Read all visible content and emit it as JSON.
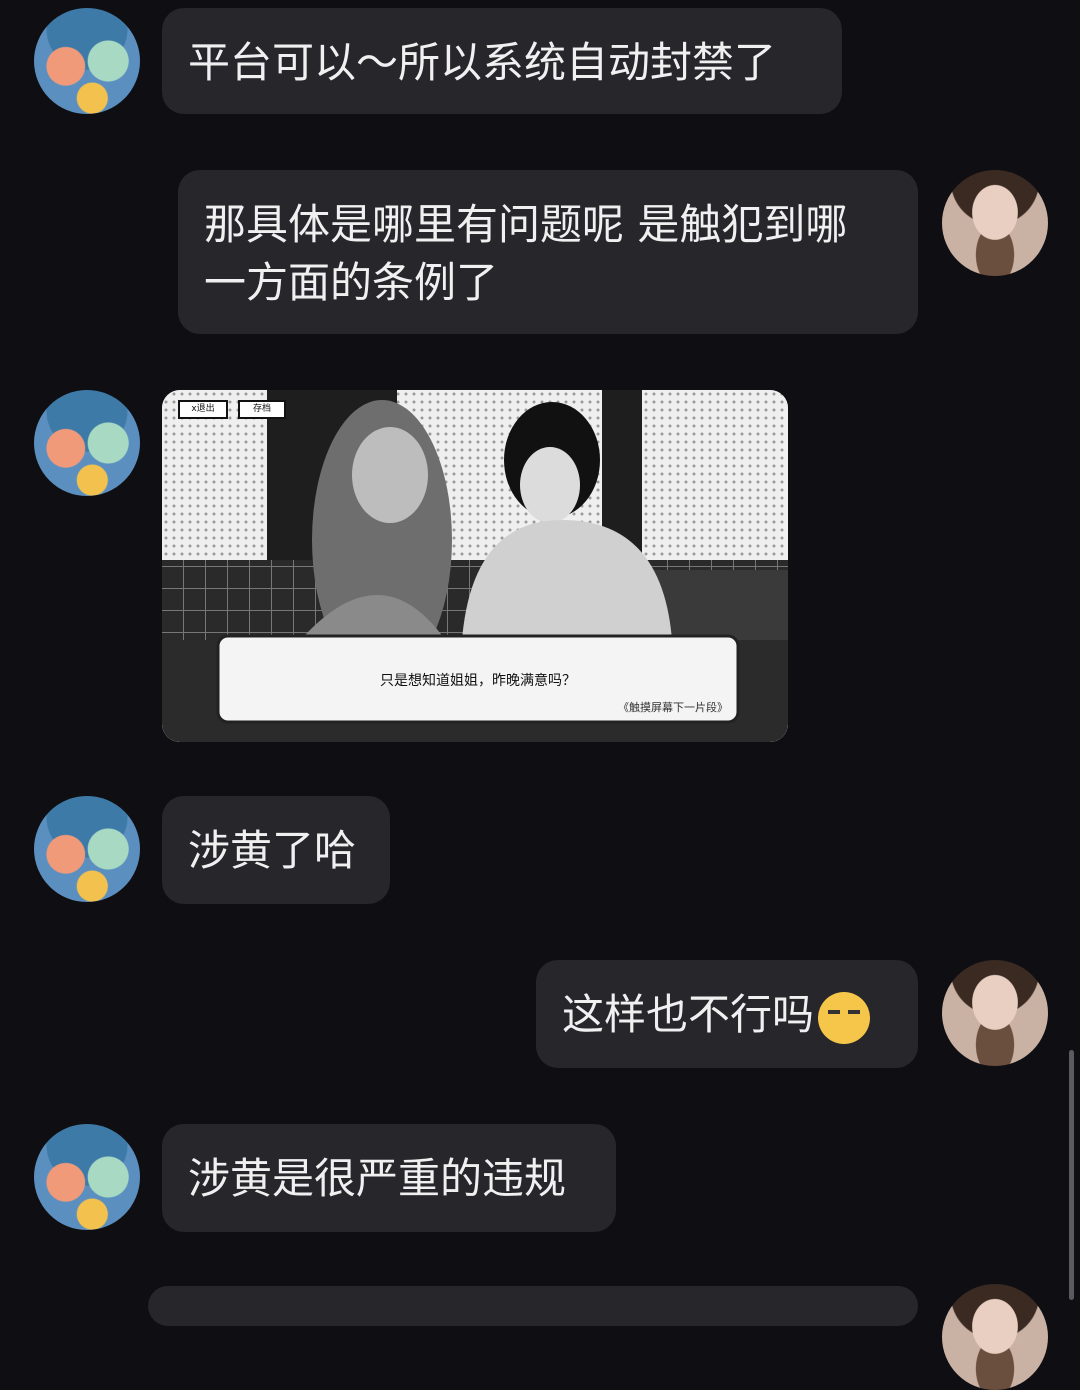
{
  "messages": [
    {
      "from": "cs",
      "lines": [
        "平台可以～所以系统自动封禁了"
      ]
    },
    {
      "from": "me",
      "lines": [
        "那具体是哪里有问题呢 是触犯到哪",
        "一方面的条例了"
      ]
    },
    {
      "from": "cs",
      "image": {
        "buttons": [
          "x退出",
          "存档"
        ],
        "dialog": "只是想知道姐姐，昨晚满意吗？",
        "hint": "《触摸屏幕下一片段》"
      }
    },
    {
      "from": "cs",
      "lines": [
        "涉黄了哈"
      ]
    },
    {
      "from": "me",
      "lines": [
        "这样也不行吗"
      ],
      "emoji": "smirk-face-emoji"
    },
    {
      "from": "cs",
      "lines": [
        "涉黄是很严重的违规"
      ]
    }
  ],
  "colors": {
    "background": "#0f0f13",
    "bubble": "#26262b",
    "text": "#f0f0f0"
  }
}
